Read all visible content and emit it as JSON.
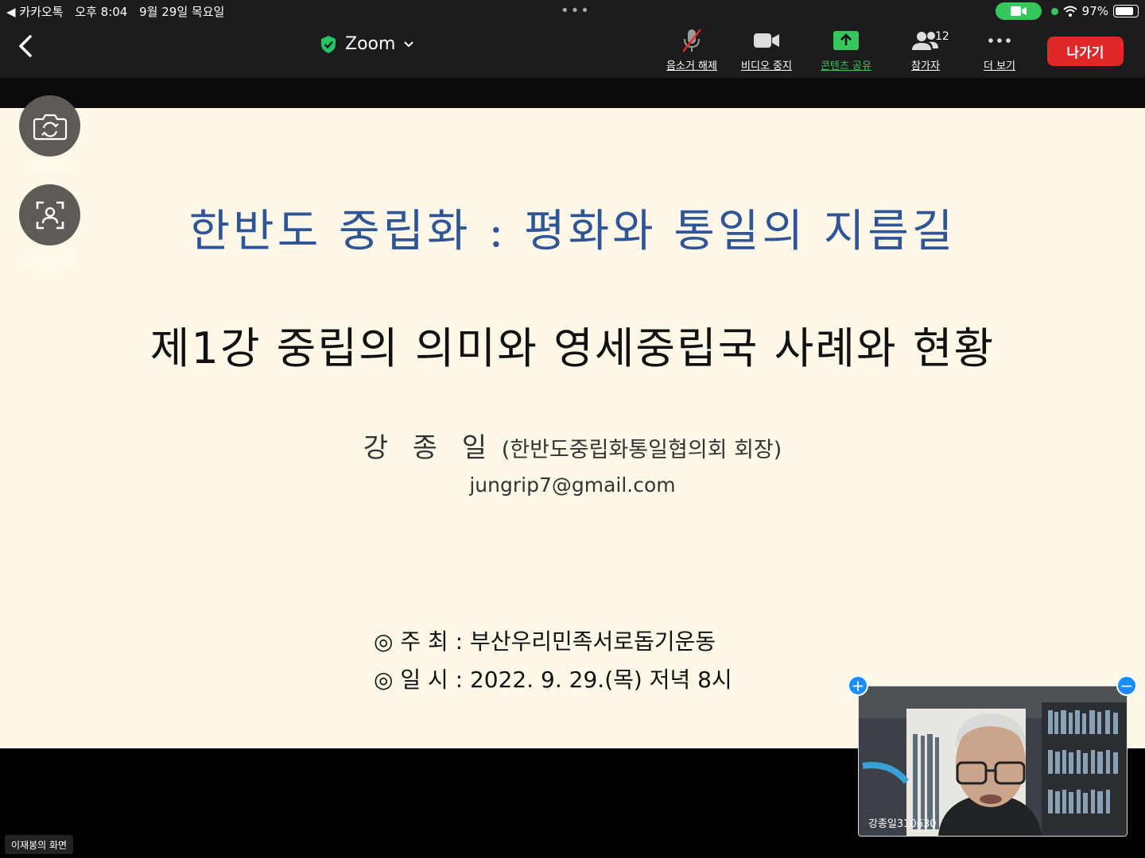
{
  "status_bar": {
    "back_app": "◀ 카카오톡",
    "time": "오후 8:04",
    "date": "9월 29일 목요일",
    "battery": "97%",
    "battery_level": 0.97
  },
  "toolbar": {
    "title": "Zoom",
    "tools": {
      "mute": "음소거 해제",
      "video": "비디오 중지",
      "share": "콘텐츠 공유",
      "participants": "참가자",
      "participants_count": "12",
      "more": "더 보기"
    },
    "leave": "나가기"
  },
  "side": {
    "switch_camera": "카메라 전환",
    "center_stage": "센터 스테이지\n끄기"
  },
  "slide": {
    "title": "한반도 중립화 : 평화와 통일의 지름길",
    "subtitle": "제1강  중립의 의미와 영세중립국 사례와 현황",
    "author_name": "강 종 일",
    "author_org": " (한반도중립화통일협의회 회장)",
    "email": "jungrip7@gmail.com",
    "host_line": "◎ 주  최 : 부산우리민족서로돕기운동",
    "date_line": "◎ 일  시 : 2022. 9. 29.(목) 저녁 8시"
  },
  "video": {
    "participant_name": "강종일310630"
  },
  "screen_share_label": "이재봉의 화면",
  "colors": {
    "leave": "#e02828",
    "share": "#35c759",
    "slide_bg": "#fdf8e8",
    "slide_title": "#2f5597",
    "pin": "#1a8cff"
  }
}
